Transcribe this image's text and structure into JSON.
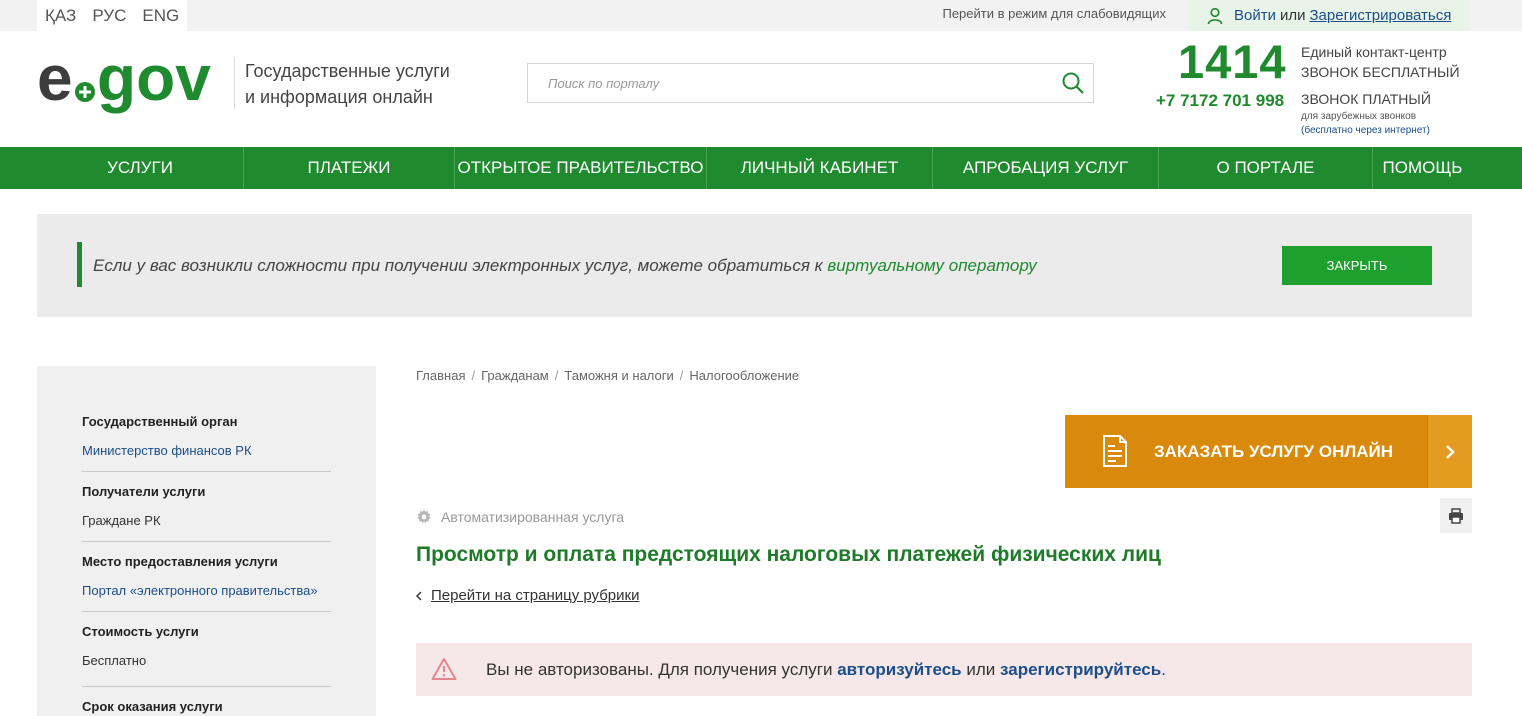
{
  "top_bar": {
    "languages": [
      "ҚАЗ",
      "РУС",
      "ENG"
    ],
    "vision_mode": "Перейти в режим для слабовидящих",
    "login": "Войти",
    "or": "или",
    "register": "Зарегистрироваться"
  },
  "header": {
    "logo_text": "e.gov",
    "tagline_line1": "Государственные услуги",
    "tagline_line2": "и информация онлайн",
    "search_placeholder": "Поиск по порталу",
    "contact_number": "1414",
    "contact_center": "Единый контакт-центр",
    "free_call": "ЗВОНОК БЕСПЛАТНЫЙ",
    "paid_number": "+7 7172 701 998",
    "paid_call": "ЗВОНОК ПЛАТНЫЙ",
    "abroad_note": "для зарубежных звонков",
    "abroad_free": "(бесплатно через интернет)"
  },
  "nav": {
    "items": [
      "УСЛУГИ",
      "ПЛАТЕЖИ",
      "ОТКРЫТОЕ ПРАВИТЕЛЬСТВО",
      "ЛИЧНЫЙ КАБИНЕТ",
      "АПРОБАЦИЯ УСЛУГ",
      "О ПОРТАЛЕ",
      "ПОМОЩЬ"
    ]
  },
  "banner": {
    "text": "Если у вас возникли сложности при получении электронных услуг, можете обратиться к",
    "link": "виртуальному оператору",
    "close_label": "ЗАКРЫТЬ"
  },
  "sidebar": {
    "blocks": [
      {
        "title": "Государственный орган",
        "value": "Министерство финансов РК"
      },
      {
        "title": "Получатели услуги",
        "value": "Граждане РК"
      },
      {
        "title": "Место предоставления услуги",
        "value": "Портал «электронного правительства»"
      },
      {
        "title": "Стоимость услуги",
        "value": "Бесплатно"
      },
      {
        "title": "Срок оказания услуги",
        "value": ""
      }
    ]
  },
  "main": {
    "breadcrumb": [
      "Главная",
      "Гражданам",
      "Таможня и налоги",
      "Налогообложение"
    ],
    "order_button": "ЗАКАЗАТЬ УСЛУГУ ОНЛАЙН",
    "service_type": "Автоматизированная услуга",
    "title": "Просмотр и оплата предстоящих налоговых платежей физических лиц",
    "back_link": "Перейти на страницу рубрики",
    "alert_prefix": "Вы не авторизованы. Для получения услуги",
    "alert_login": "авторизуйтесь",
    "alert_or": "или",
    "alert_register": "зарегистрируйтесь",
    "alert_suffix": "."
  },
  "colors": {
    "brand_green": "#1f8a2e",
    "order_orange": "#d98a0a",
    "alert_bg": "#f6e7e8",
    "link_blue": "#1b4f8a"
  },
  "icons": [
    "user-icon",
    "search-icon",
    "gear-icon",
    "print-icon",
    "document-icon",
    "chevron-right-icon",
    "chevron-left-icon",
    "warning-icon"
  ]
}
